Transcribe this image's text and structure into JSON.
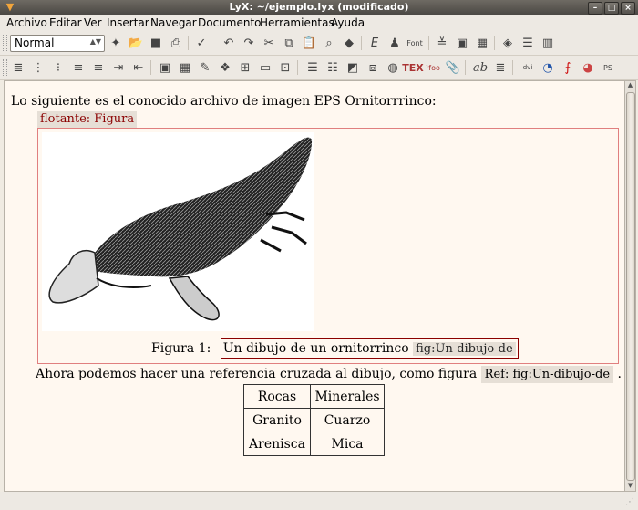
{
  "window": {
    "title": "LyX: ~/ejemplo.lyx (modificado)"
  },
  "menu": [
    "Archivo",
    "Editar",
    "Ver",
    "Insertar",
    "Navegar",
    "Documento",
    "Herramientas",
    "Ayuda"
  ],
  "toolbar": {
    "paragraph_style": "Normal"
  },
  "document": {
    "intro": "Lo siguiente es el conocido archivo de imagen EPS Ornitorrrinco:",
    "float_label": "flotante: Figura",
    "caption_prefix": "Figura 1:",
    "caption_text": "Un dibujo de un ornitorrinco",
    "caption_label": "fig:Un-dibujo-de",
    "crossref_text": "Ahora podemos hacer una referencia cruzada al dibujo, como figura",
    "crossref_label": "Ref: fig:Un-dibujo-de",
    "crossref_end": ".",
    "table": [
      [
        "Rocas",
        "Minerales"
      ],
      [
        "Granito",
        "Cuarzo"
      ],
      [
        "Arenisca",
        "Mica"
      ]
    ]
  }
}
